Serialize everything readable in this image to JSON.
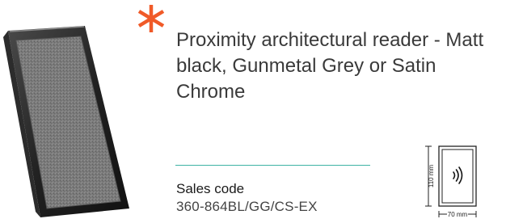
{
  "product": {
    "title": "Proximity architectural reader - Matt black, Gunmetal Grey or Satin Chrome",
    "sales_code_label": "Sales code",
    "sales_code": "360-864BL/GG/CS-EX"
  },
  "diagram": {
    "height_label": "110 mm",
    "width_label": "70 mm"
  },
  "colors": {
    "accent_asterisk": "#f05a28",
    "divider": "#3fb3a4"
  },
  "icons": {
    "asterisk": "asterisk-icon",
    "contactless": "contactless-icon"
  }
}
